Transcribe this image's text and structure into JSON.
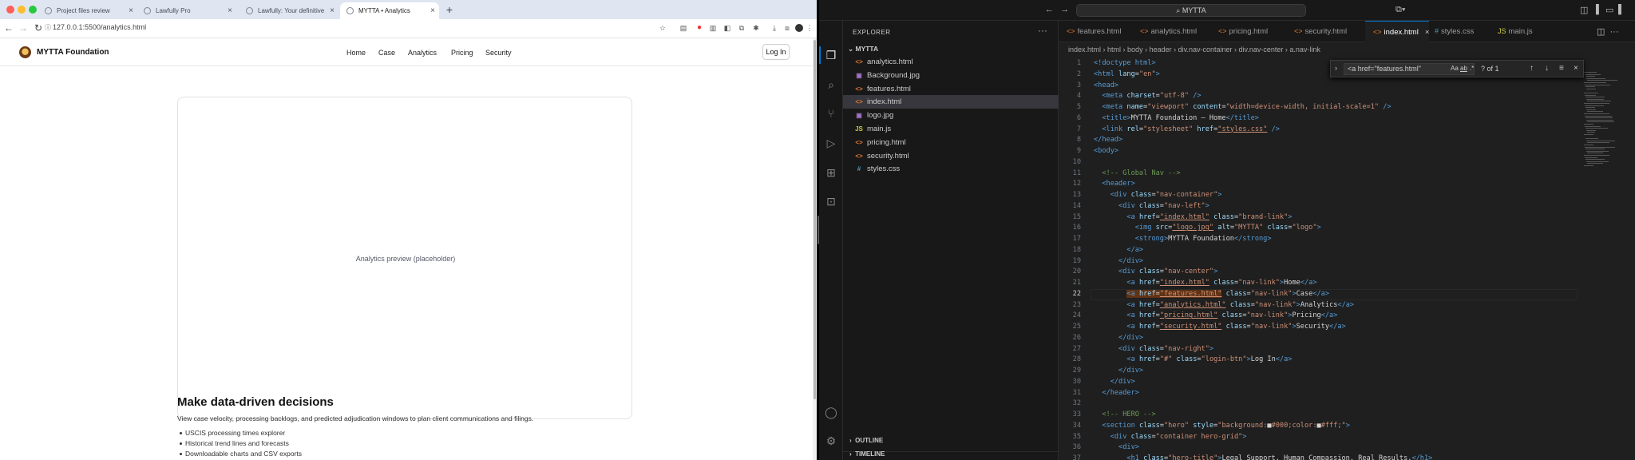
{
  "browser": {
    "tabs": [
      {
        "title": "Project files review",
        "active": false
      },
      {
        "title": "Lawfully Pro",
        "active": false
      },
      {
        "title": "Lawfully: Your definitive US ...",
        "active": false
      },
      {
        "title": "MYTTA • Analytics",
        "active": true
      }
    ],
    "url": "127.0.0.1:5500/analytics.html"
  },
  "site": {
    "brand": "MYTTA Foundation",
    "nav": [
      "Home",
      "Case",
      "Analytics",
      "Pricing",
      "Security"
    ],
    "login": "Log In",
    "preview_text": "Analytics preview (placeholder)",
    "heading": "Make data-driven decisions",
    "lead": "View case velocity, processing backlogs, and predicted adjudication windows to plan client communications and filings.",
    "bullets": [
      "USCIS processing times explorer",
      "Historical trend lines and forecasts",
      "Downloadable charts and CSV exports"
    ]
  },
  "vscode": {
    "search": "MYTTA",
    "explorer_title": "EXPLORER",
    "folder": "MYTTA",
    "files": [
      {
        "name": "analytics.html",
        "icon": "<>",
        "color": "#e37933",
        "selected": false
      },
      {
        "name": "Background.jpg",
        "icon": "▣",
        "color": "#a074c4",
        "selected": false
      },
      {
        "name": "features.html",
        "icon": "<>",
        "color": "#e37933",
        "selected": false
      },
      {
        "name": "index.html",
        "icon": "<>",
        "color": "#e37933",
        "selected": true
      },
      {
        "name": "logo.jpg",
        "icon": "▣",
        "color": "#a074c4",
        "selected": false
      },
      {
        "name": "main.js",
        "icon": "JS",
        "color": "#cbcb41",
        "selected": false
      },
      {
        "name": "pricing.html",
        "icon": "<>",
        "color": "#e37933",
        "selected": false
      },
      {
        "name": "security.html",
        "icon": "<>",
        "color": "#e37933",
        "selected": false
      },
      {
        "name": "styles.css",
        "icon": "#",
        "color": "#519aba",
        "selected": false
      }
    ],
    "outline": "OUTLINE",
    "timeline": "TIMELINE",
    "editor_tabs": [
      {
        "name": "features.html",
        "icon": "<>",
        "color": "#e37933",
        "active": false
      },
      {
        "name": "analytics.html",
        "icon": "<>",
        "color": "#e37933",
        "active": false
      },
      {
        "name": "pricing.html",
        "icon": "<>",
        "color": "#e37933",
        "active": false
      },
      {
        "name": "security.html",
        "icon": "<>",
        "color": "#e37933",
        "active": false
      },
      {
        "name": "index.html",
        "icon": "<>",
        "color": "#e37933",
        "active": true
      },
      {
        "name": "styles.css",
        "icon": "#",
        "color": "#519aba",
        "active": false
      },
      {
        "name": "main.js",
        "icon": "JS",
        "color": "#cbcb41",
        "active": false
      }
    ],
    "breadcrumbs": [
      "index.html",
      "html",
      "body",
      "header",
      "div.nav-container",
      "div.nav-center",
      "a.nav-link"
    ],
    "find": {
      "query": "<a href=\"features.html\"",
      "case": "Aa",
      "word": "ab",
      "regex": ".*",
      "count": "? of 1"
    },
    "current_line": 22,
    "code": [
      [
        [
          "t",
          "<!doctype html>"
        ]
      ],
      [
        [
          "t",
          "<html "
        ],
        [
          "a",
          "lang"
        ],
        [
          "tx",
          "="
        ],
        [
          "s",
          "\"en\""
        ],
        [
          "t",
          ">"
        ]
      ],
      [
        [
          "t",
          "<head>"
        ]
      ],
      [
        [
          "tx",
          "  "
        ],
        [
          "t",
          "<meta "
        ],
        [
          "a",
          "charset"
        ],
        [
          "tx",
          "="
        ],
        [
          "s",
          "\"utf-8\""
        ],
        [
          "t",
          " />"
        ]
      ],
      [
        [
          "tx",
          "  "
        ],
        [
          "t",
          "<meta "
        ],
        [
          "a",
          "name"
        ],
        [
          "tx",
          "="
        ],
        [
          "s",
          "\"viewport\""
        ],
        [
          "tx",
          " "
        ],
        [
          "a",
          "content"
        ],
        [
          "tx",
          "="
        ],
        [
          "s",
          "\"width=device-width, initial-scale=1\""
        ],
        [
          "t",
          " />"
        ]
      ],
      [
        [
          "tx",
          "  "
        ],
        [
          "t",
          "<title>"
        ],
        [
          "tx",
          "MYTTA Foundation — Home"
        ],
        [
          "t",
          "</title>"
        ]
      ],
      [
        [
          "tx",
          "  "
        ],
        [
          "t",
          "<link "
        ],
        [
          "a",
          "rel"
        ],
        [
          "tx",
          "="
        ],
        [
          "s",
          "\"stylesheet\""
        ],
        [
          "tx",
          " "
        ],
        [
          "a",
          "href"
        ],
        [
          "tx",
          "="
        ],
        [
          "su",
          "\"styles.css\""
        ],
        [
          "t",
          " />"
        ]
      ],
      [
        [
          "t",
          "</head>"
        ]
      ],
      [
        [
          "t",
          "<body>"
        ]
      ],
      [],
      [
        [
          "tx",
          "  "
        ],
        [
          "c",
          "<!-- Global Nav -->"
        ]
      ],
      [
        [
          "tx",
          "  "
        ],
        [
          "t",
          "<header>"
        ]
      ],
      [
        [
          "tx",
          "    "
        ],
        [
          "t",
          "<div "
        ],
        [
          "a",
          "class"
        ],
        [
          "tx",
          "="
        ],
        [
          "s",
          "\"nav-container\""
        ],
        [
          "t",
          ">"
        ]
      ],
      [
        [
          "tx",
          "      "
        ],
        [
          "t",
          "<div "
        ],
        [
          "a",
          "class"
        ],
        [
          "tx",
          "="
        ],
        [
          "s",
          "\"nav-left\""
        ],
        [
          "t",
          ">"
        ]
      ],
      [
        [
          "tx",
          "        "
        ],
        [
          "t",
          "<a "
        ],
        [
          "a",
          "href"
        ],
        [
          "tx",
          "="
        ],
        [
          "su",
          "\"index.html\""
        ],
        [
          "tx",
          " "
        ],
        [
          "a",
          "class"
        ],
        [
          "tx",
          "="
        ],
        [
          "s",
          "\"brand-link\""
        ],
        [
          "t",
          ">"
        ]
      ],
      [
        [
          "tx",
          "          "
        ],
        [
          "t",
          "<img "
        ],
        [
          "a",
          "src"
        ],
        [
          "tx",
          "="
        ],
        [
          "su",
          "\"logo.jpg\""
        ],
        [
          "tx",
          " "
        ],
        [
          "a",
          "alt"
        ],
        [
          "tx",
          "="
        ],
        [
          "s",
          "\"MYTTA\""
        ],
        [
          "tx",
          " "
        ],
        [
          "a",
          "class"
        ],
        [
          "tx",
          "="
        ],
        [
          "s",
          "\"logo\""
        ],
        [
          "t",
          ">"
        ]
      ],
      [
        [
          "tx",
          "          "
        ],
        [
          "t",
          "<strong>"
        ],
        [
          "tx",
          "MYTTA Foundation"
        ],
        [
          "t",
          "</strong>"
        ]
      ],
      [
        [
          "tx",
          "        "
        ],
        [
          "t",
          "</a>"
        ]
      ],
      [
        [
          "tx",
          "      "
        ],
        [
          "t",
          "</div>"
        ]
      ],
      [
        [
          "tx",
          "      "
        ],
        [
          "t",
          "<div "
        ],
        [
          "a",
          "class"
        ],
        [
          "tx",
          "="
        ],
        [
          "s",
          "\"nav-center\""
        ],
        [
          "t",
          ">"
        ]
      ],
      [
        [
          "tx",
          "        "
        ],
        [
          "t",
          "<a "
        ],
        [
          "a",
          "href"
        ],
        [
          "tx",
          "="
        ],
        [
          "su",
          "\"index.html\""
        ],
        [
          "tx",
          " "
        ],
        [
          "a",
          "class"
        ],
        [
          "tx",
          "="
        ],
        [
          "s",
          "\"nav-link\""
        ],
        [
          "t",
          ">"
        ],
        [
          "tx",
          "Home"
        ],
        [
          "t",
          "</a>"
        ]
      ],
      [
        [
          "tx",
          "        "
        ],
        [
          "th",
          "<a "
        ],
        [
          "ah",
          "href"
        ],
        [
          "txh",
          "="
        ],
        [
          "suh",
          "\"features.html\""
        ],
        [
          "tx",
          " "
        ],
        [
          "a",
          "class"
        ],
        [
          "tx",
          "="
        ],
        [
          "s",
          "\"nav-link\""
        ],
        [
          "t",
          ">"
        ],
        [
          "tx",
          "Case"
        ],
        [
          "t",
          "</a>"
        ]
      ],
      [
        [
          "tx",
          "        "
        ],
        [
          "t",
          "<a "
        ],
        [
          "a",
          "href"
        ],
        [
          "tx",
          "="
        ],
        [
          "su",
          "\"analytics.html\""
        ],
        [
          "tx",
          " "
        ],
        [
          "a",
          "class"
        ],
        [
          "tx",
          "="
        ],
        [
          "s",
          "\"nav-link\""
        ],
        [
          "t",
          ">"
        ],
        [
          "tx",
          "Analytics"
        ],
        [
          "t",
          "</a>"
        ]
      ],
      [
        [
          "tx",
          "        "
        ],
        [
          "t",
          "<a "
        ],
        [
          "a",
          "href"
        ],
        [
          "tx",
          "="
        ],
        [
          "su",
          "\"pricing.html\""
        ],
        [
          "tx",
          " "
        ],
        [
          "a",
          "class"
        ],
        [
          "tx",
          "="
        ],
        [
          "s",
          "\"nav-link\""
        ],
        [
          "t",
          ">"
        ],
        [
          "tx",
          "Pricing"
        ],
        [
          "t",
          "</a>"
        ]
      ],
      [
        [
          "tx",
          "        "
        ],
        [
          "t",
          "<a "
        ],
        [
          "a",
          "href"
        ],
        [
          "tx",
          "="
        ],
        [
          "su",
          "\"security.html\""
        ],
        [
          "tx",
          " "
        ],
        [
          "a",
          "class"
        ],
        [
          "tx",
          "="
        ],
        [
          "s",
          "\"nav-link\""
        ],
        [
          "t",
          ">"
        ],
        [
          "tx",
          "Security"
        ],
        [
          "t",
          "</a>"
        ]
      ],
      [
        [
          "tx",
          "      "
        ],
        [
          "t",
          "</div>"
        ]
      ],
      [
        [
          "tx",
          "      "
        ],
        [
          "t",
          "<div "
        ],
        [
          "a",
          "class"
        ],
        [
          "tx",
          "="
        ],
        [
          "s",
          "\"nav-right\""
        ],
        [
          "t",
          ">"
        ]
      ],
      [
        [
          "tx",
          "        "
        ],
        [
          "t",
          "<a "
        ],
        [
          "a",
          "href"
        ],
        [
          "tx",
          "="
        ],
        [
          "s",
          "\"#\""
        ],
        [
          "tx",
          " "
        ],
        [
          "a",
          "class"
        ],
        [
          "tx",
          "="
        ],
        [
          "s",
          "\"login-btn\""
        ],
        [
          "t",
          ">"
        ],
        [
          "tx",
          "Log In"
        ],
        [
          "t",
          "</a>"
        ]
      ],
      [
        [
          "tx",
          "      "
        ],
        [
          "t",
          "</div>"
        ]
      ],
      [
        [
          "tx",
          "    "
        ],
        [
          "t",
          "</div>"
        ]
      ],
      [
        [
          "tx",
          "  "
        ],
        [
          "t",
          "</header>"
        ]
      ],
      [],
      [
        [
          "tx",
          "  "
        ],
        [
          "c",
          "<!-- HERO -->"
        ]
      ],
      [
        [
          "tx",
          "  "
        ],
        [
          "t",
          "<section "
        ],
        [
          "a",
          "class"
        ],
        [
          "tx",
          "="
        ],
        [
          "s",
          "\"hero\""
        ],
        [
          "tx",
          " "
        ],
        [
          "a",
          "style"
        ],
        [
          "tx",
          "="
        ],
        [
          "s",
          "\"background:"
        ],
        [
          "tx",
          "■"
        ],
        [
          "s",
          "#000;color:"
        ],
        [
          "tx",
          "■"
        ],
        [
          "s",
          "#fff;\""
        ],
        [
          "t",
          ">"
        ]
      ],
      [
        [
          "tx",
          "    "
        ],
        [
          "t",
          "<div "
        ],
        [
          "a",
          "class"
        ],
        [
          "tx",
          "="
        ],
        [
          "s",
          "\"container hero-grid\""
        ],
        [
          "t",
          ">"
        ]
      ],
      [
        [
          "tx",
          "      "
        ],
        [
          "t",
          "<div>"
        ]
      ],
      [
        [
          "tx",
          "        "
        ],
        [
          "t",
          "<h1 "
        ],
        [
          "a",
          "class"
        ],
        [
          "tx",
          "="
        ],
        [
          "s",
          "\"hero-title\""
        ],
        [
          "t",
          ">"
        ],
        [
          "tx",
          "Legal Support. Human Compassion. Real Results."
        ],
        [
          "t",
          "</h1>"
        ]
      ]
    ]
  }
}
